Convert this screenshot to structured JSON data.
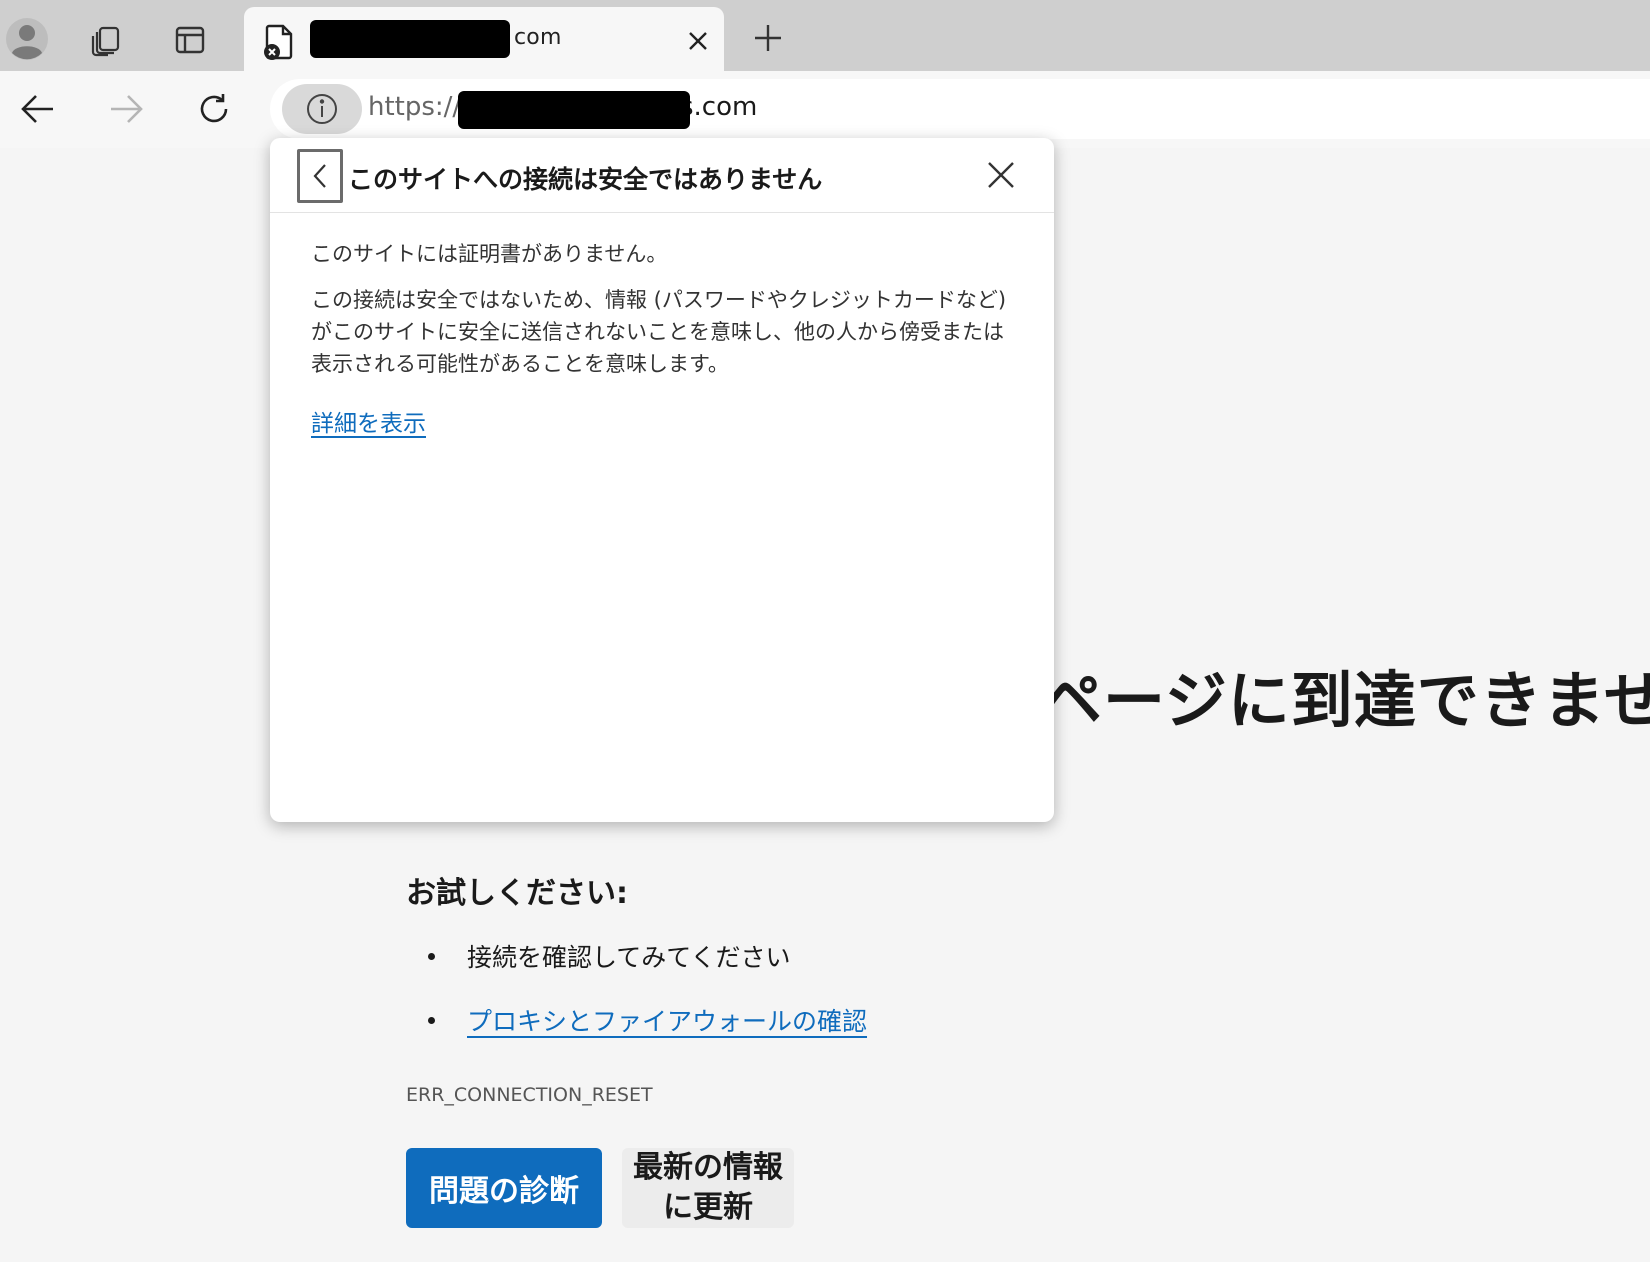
{
  "tab": {
    "title_suffix": "com"
  },
  "address_bar": {
    "scheme": "https://",
    "domain_suffix": "s.com"
  },
  "popup": {
    "title": "このサイトへの接続は安全ではありません",
    "line1": "このサイトには証明書がありません。",
    "line2": "この接続は安全ではないため、情報 (パスワードやクレジットカードなど) がこのサイトに安全に送信されないことを意味し、他の人から傍受または表示される可能性があることを意味します。",
    "details_link": "詳細を表示"
  },
  "error_page": {
    "heading": "ページに到達できません",
    "try_title": "お試しください:",
    "suggestions": [
      "接続を確認してみてください",
      "プロキシとファイアウォールの確認"
    ],
    "error_code": "ERR_CONNECTION_RESET",
    "diagnose_button": "問題の診断",
    "refresh_button": "最新の情報に更新"
  },
  "colors": {
    "accent": "#0f6cbd",
    "page_bg": "#f5f5f5",
    "tabstrip_bg": "#cfcfcf"
  }
}
